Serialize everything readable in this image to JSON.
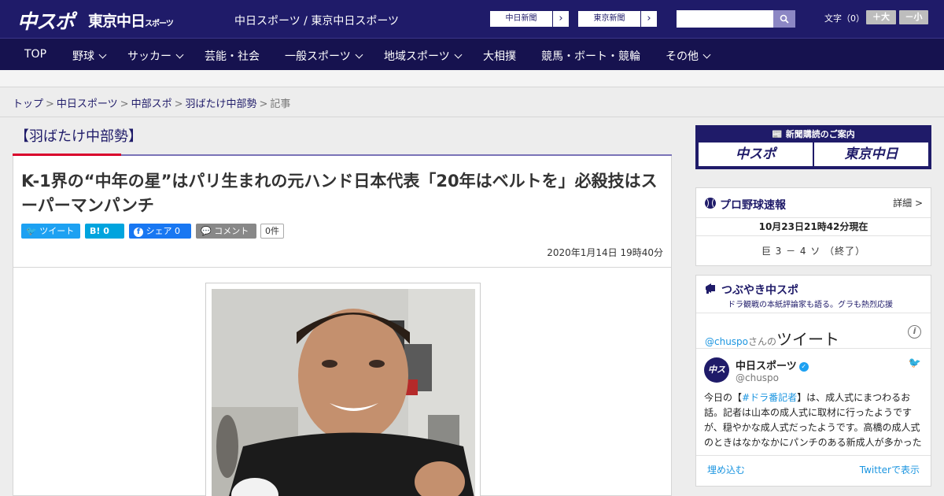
{
  "header": {
    "logo_main": "中スポ",
    "logo_tokyo": "東京中日",
    "logo_tokyo_sub": "スポーツ",
    "site_title": "中日スポーツ / 東京中日スポーツ",
    "ext_links": [
      "中日新聞",
      "東京新聞"
    ],
    "font_size_label": "文字（0）",
    "font_bigger": "＋大",
    "font_smaller": "－小"
  },
  "nav": {
    "items": [
      {
        "label": "TOP",
        "has_menu": false
      },
      {
        "label": "野球",
        "has_menu": true
      },
      {
        "label": "サッカー",
        "has_menu": true
      },
      {
        "label": "芸能・社会",
        "has_menu": false
      },
      {
        "label": "一般スポーツ",
        "has_menu": true
      },
      {
        "label": "地域スポーツ",
        "has_menu": true
      },
      {
        "label": "大相撲",
        "has_menu": false
      },
      {
        "label": "競馬・ボート・競輪",
        "has_menu": false
      },
      {
        "label": "その他",
        "has_menu": true
      }
    ]
  },
  "breadcrumb": {
    "items": [
      "トップ",
      "中日スポーツ",
      "中部スポ",
      "羽ばたけ中部勢"
    ],
    "current": "記事",
    "separator": ">"
  },
  "article": {
    "category": "【羽ばたけ中部勢】",
    "title": "K-1界の“中年の星”はパリ生まれの元ハンド日本代表「20年はベルトを」必殺技はスーパーマンパンチ",
    "share": {
      "tweet": "ツイート",
      "hatena_count": "0",
      "facebook": "シェア 0",
      "comment": "コメント",
      "comment_count": "0件"
    },
    "date": "2020年1月14日 19時40分"
  },
  "sidebar": {
    "subscribe_title": "新聞購読のご案内",
    "subscribe_buttons": [
      "中スポ",
      "東京中日"
    ],
    "baseball": {
      "title": "プロ野球速報",
      "detail": "詳細 >",
      "timestamp": "10月23日21時42分現在",
      "score": "巨 3 － 4 ソ （終了）"
    },
    "tsubuyaki": {
      "title": "つぶやき中スポ",
      "subtitle": "ドラ観戦の本紙評論家も語る。グラも熱烈応援",
      "handle": "@chuspo",
      "handle_suffix": "さんの",
      "tweets_label": "ツイート",
      "tweet_name": "中日スポーツ",
      "tweet_user": "@chuspo",
      "tweet_text_pre": "今日の【",
      "tweet_hashtag": "#ドラ番記者",
      "tweet_text_post": "】は、成人式にまつわるお話。記者は山本の成人式に取材に行ったようですが、穏やかな成人式だったようです。高橋の成人式のときはなかなかにパンチのある新成人が多かった",
      "embed": "埋め込む",
      "view_on_twitter": "Twitterで表示"
    }
  },
  "colors": {
    "header_bg": "#1f1b69",
    "nav_bg": "#16124f",
    "accent_red": "#d9002b",
    "twitter_blue": "#1da1f2",
    "facebook_blue": "#1877f2",
    "hatena_blue": "#00a4de",
    "comment_gray": "#888888"
  },
  "icons": [
    "search-icon",
    "chevron-down-icon",
    "twitter-icon",
    "hatena-icon",
    "facebook-icon",
    "comment-icon",
    "baseball-icon",
    "megaphone-icon",
    "info-icon",
    "verified-icon"
  ]
}
